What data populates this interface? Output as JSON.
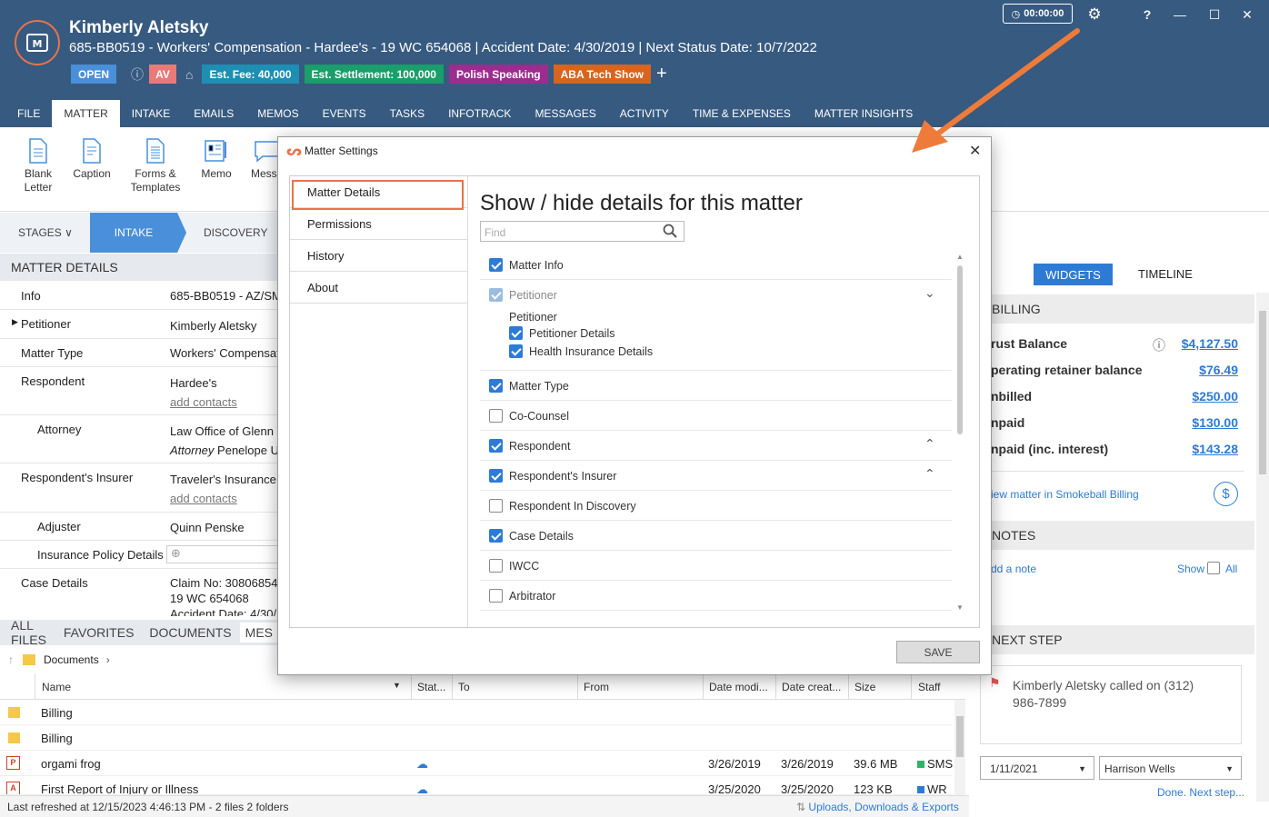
{
  "header": {
    "client_name": "Kimberly Aletsky",
    "matter_line": "685-BB0519 - Workers' Compensation - Hardee's - 19 WC 654068 | Accident Date: 4/30/2019 | Next Status Date: 10/7/2022",
    "tags": [
      {
        "label": "OPEN",
        "color": "#4a8fd9"
      },
      {
        "label": "AV",
        "color": "#e87a7a"
      },
      {
        "label": "Est. Fee: 40,000",
        "color": "#1e8fb3"
      },
      {
        "label": "Est. Settlement: 100,000",
        "color": "#1a9e6a"
      },
      {
        "label": "Polish Speaking",
        "color": "#9b2d8f"
      },
      {
        "label": "ABA Tech Show",
        "color": "#d9641e"
      }
    ],
    "add_tag": "+",
    "timer": "00:00:00",
    "help": "?",
    "minimize": "—",
    "maximize": "☐",
    "close": "✕"
  },
  "tabs": [
    "FILE",
    "MATTER",
    "INTAKE",
    "EMAILS",
    "MEMOS",
    "EVENTS",
    "TASKS",
    "INFOTRACK",
    "MESSAGES",
    "ACTIVITY",
    "TIME & EXPENSES",
    "MATTER INSIGHTS"
  ],
  "ribbon": {
    "blank_letter_1": "Blank",
    "blank_letter_2": "Letter",
    "caption": "Caption",
    "forms_1": "Forms &",
    "forms_2": "Templates",
    "memo": "Memo",
    "messages": "Mess"
  },
  "stages": {
    "label": "STAGES",
    "current": "INTAKE",
    "next": "DISCOVERY"
  },
  "matter_details": {
    "title": "MATTER DETAILS",
    "rows": [
      {
        "label": "Info",
        "value": "685-BB0519 - AZ/SM"
      },
      {
        "label": "Petitioner",
        "value": "Kimberly Aletsky"
      },
      {
        "label": "Matter Type",
        "value": "Workers' Compensat"
      },
      {
        "label": "Respondent",
        "value": "Hardee's",
        "link": "add contacts"
      },
      {
        "label": "Attorney",
        "value": "Law Office of Glenn F",
        "value2_prefix": "Attorney",
        "value2": "Penelope U"
      },
      {
        "label": "Respondent's Insurer",
        "value": "Traveler's Insurance C",
        "link": "add contacts"
      },
      {
        "label": "Adjuster",
        "value": "Quinn Penske"
      },
      {
        "label": "Insurance Policy Details",
        "value": ""
      },
      {
        "label": "Case Details",
        "value": "Claim No: 30806854",
        "value2": "19 WC 654068",
        "value3": "Accident Date: 4/30/"
      }
    ]
  },
  "file_tabs": [
    "ALL FILES",
    "FAVORITES",
    "DOCUMENTS",
    "MES"
  ],
  "breadcrumb": "Documents",
  "grid": {
    "columns": [
      "Name",
      "Stat...",
      "To",
      "From",
      "Date modi...",
      "Date creat...",
      "Size",
      "Staff"
    ],
    "rows": [
      {
        "name": "Billing",
        "type": "folder"
      },
      {
        "name": "Billing",
        "type": "folder"
      },
      {
        "name": "orgami frog",
        "type": "ppt",
        "modified": "3/26/2019",
        "created": "3/26/2019",
        "size": "39.6 MB",
        "staff": "SMS"
      },
      {
        "name": "First Report of Injury or Illness",
        "type": "pdf",
        "modified": "3/25/2020",
        "created": "3/25/2020",
        "size": "123 KB",
        "staff": "WR"
      }
    ]
  },
  "status_bar": {
    "text": "Last refreshed at 12/15/2023 4:46:13 PM  -  2 files  2 folders",
    "link": "Uploads, Downloads & Exports"
  },
  "right_panel": {
    "tab_widgets": "WIDGETS",
    "tab_timeline": "TIMELINE",
    "billing_title": "BILLING",
    "billing_rows": [
      {
        "label": "rust Balance",
        "value": "$4,127.50"
      },
      {
        "label": "perating retainer balance",
        "value": "$76.49"
      },
      {
        "label": "nbilled",
        "value": "$250.00"
      },
      {
        "label": "npaid",
        "value": "$130.00"
      },
      {
        "label": "npaid (inc. interest)",
        "value": "$143.28"
      }
    ],
    "view_billing": "iew matter in Smokeball Billing",
    "notes_title": "NOTES",
    "add_note": "dd a note",
    "show": "Show",
    "all": "All",
    "next_step_title": "NEXT STEP",
    "next_step_text": "Kimberly Aletsky called on (312) 986-7899",
    "date": "1/11/2021",
    "staff": "Harrison Wells",
    "done": "Done. Next step..."
  },
  "modal": {
    "title": "Matter Settings",
    "close": "✕",
    "nav": [
      "Matter Details",
      "Permissions",
      "History",
      "About"
    ],
    "heading": "Show / hide details for this matter",
    "find_placeholder": "Find",
    "items": [
      {
        "label": "Matter Info",
        "checked": true
      },
      {
        "label": "Petitioner",
        "checked": true,
        "disabled": true,
        "group": "Petitioner",
        "subs": [
          {
            "label": "Petitioner Details",
            "checked": true
          },
          {
            "label": "Health Insurance Details",
            "checked": true
          }
        ]
      },
      {
        "label": "Matter Type",
        "checked": true
      },
      {
        "label": "Co-Counsel",
        "checked": false
      },
      {
        "label": "Respondent",
        "checked": true
      },
      {
        "label": "Respondent's Insurer",
        "checked": true
      },
      {
        "label": "Respondent In Discovery",
        "checked": false
      },
      {
        "label": "Case Details",
        "checked": true
      },
      {
        "label": "IWCC",
        "checked": false
      },
      {
        "label": "Arbitrator",
        "checked": false
      }
    ],
    "save": "SAVE"
  }
}
